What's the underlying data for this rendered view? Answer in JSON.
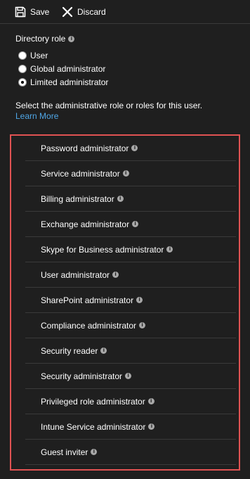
{
  "toolbar": {
    "save_label": "Save",
    "discard_label": "Discard"
  },
  "directory_role": {
    "title": "Directory role",
    "options": [
      {
        "label": "User",
        "selected": false
      },
      {
        "label": "Global administrator",
        "selected": false
      },
      {
        "label": "Limited administrator",
        "selected": true
      }
    ]
  },
  "description": "Select the administrative role or roles for this user.",
  "learn_more": "Learn More",
  "roles": [
    "Password administrator",
    "Service administrator",
    "Billing administrator",
    "Exchange administrator",
    "Skype for Business administrator",
    "User administrator",
    "SharePoint administrator",
    "Compliance administrator",
    "Security reader",
    "Security administrator",
    "Privileged role administrator",
    "Intune Service administrator",
    "Guest inviter"
  ],
  "colors": {
    "background": "#1f1f1f",
    "highlight_border": "#e05252",
    "link": "#4fa6e6"
  },
  "icons": {
    "save": "save-icon",
    "discard": "close-icon",
    "info": "info-icon"
  }
}
